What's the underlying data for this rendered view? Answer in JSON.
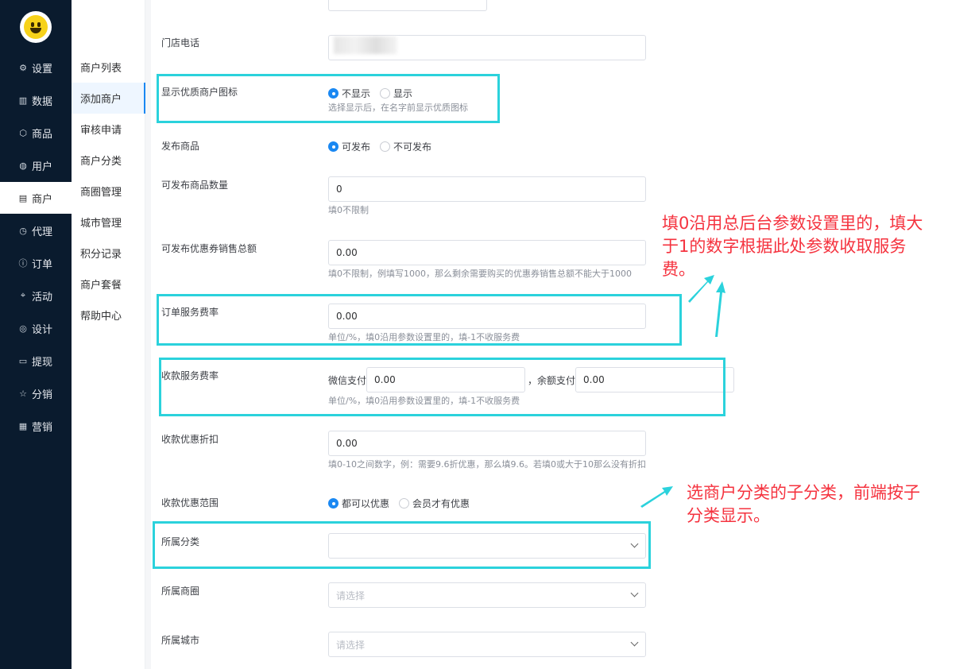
{
  "sidebar": {
    "items": [
      {
        "icon": "gear-icon",
        "glyph": "⚙",
        "label": "设置"
      },
      {
        "icon": "bar-chart-icon",
        "glyph": "▥",
        "label": "数据"
      },
      {
        "icon": "cube-icon",
        "glyph": "⬡",
        "label": "商品"
      },
      {
        "icon": "user-icon",
        "glyph": "◍",
        "label": "用户"
      },
      {
        "icon": "document-icon",
        "glyph": "▤",
        "label": "商户"
      },
      {
        "icon": "clock-icon",
        "glyph": "◷",
        "label": "代理"
      },
      {
        "icon": "info-icon",
        "glyph": "ⓘ",
        "label": "订单"
      },
      {
        "icon": "tag-icon",
        "glyph": "⌖",
        "label": "活动"
      },
      {
        "icon": "palette-icon",
        "glyph": "◎",
        "label": "设计"
      },
      {
        "icon": "card-icon",
        "glyph": "▭",
        "label": "提现"
      },
      {
        "icon": "star-icon",
        "glyph": "☆",
        "label": "分销"
      },
      {
        "icon": "grid-icon",
        "glyph": "▦",
        "label": "营销"
      }
    ],
    "active_index": 4
  },
  "subnav": {
    "items": [
      "商户列表",
      "添加商户",
      "审核申请",
      "商户分类",
      "商圈管理",
      "城市管理",
      "积分记录",
      "商户套餐",
      "帮助中心"
    ],
    "active_index": 1
  },
  "form": {
    "store_phone": {
      "label": "门店电话"
    },
    "show_quality": {
      "label": "显示优质商户图标",
      "options": [
        "不显示",
        "显示"
      ],
      "selected": 0,
      "hint": "选择显示后，在名字前显示优质图标"
    },
    "publish_goods": {
      "label": "发布商品",
      "options": [
        "可发布",
        "不可发布"
      ],
      "selected": 0
    },
    "goods_count": {
      "label": "可发布商品数量",
      "value": "0",
      "hint": "填0不限制"
    },
    "coupon_total": {
      "label": "可发布优惠券销售总额",
      "value": "0.00",
      "hint": "填0不限制，例填写1000，那么剩余需要购买的优惠券销售总额不能大于1000"
    },
    "order_fee": {
      "label": "订单服务费率",
      "value": "0.00",
      "hint": "单位/%，填0沿用参数设置里的，填-1不收服务费"
    },
    "collect_fee": {
      "label": "收款服务费率",
      "wechat_label": "微信支付",
      "wechat_value": "0.00",
      "sep": "，余额支付",
      "balance_value": "0.00",
      "hint": "单位/%，填0沿用参数设置里的，填-1不收服务费"
    },
    "collect_discount": {
      "label": "收款优惠折扣",
      "value": "0.00",
      "hint": "填0-10之间数字，例：需要9.6折优惠，那么填9.6。若填0或大于10那么没有折扣"
    },
    "discount_scope": {
      "label": "收款优惠范围",
      "options": [
        "都可以优惠",
        "会员才有优惠"
      ],
      "selected": 0
    },
    "category": {
      "label": "所属分类",
      "value": ""
    },
    "business_circle": {
      "label": "所属商圈",
      "placeholder": "请选择"
    },
    "city": {
      "label": "所属城市",
      "placeholder": "请选择"
    }
  },
  "annotations": {
    "fee_note": [
      "填0沿用总后台参数设置里的，填大",
      "于1的数字根据此处参数收取服务",
      "费。"
    ],
    "category_note": [
      "选商户分类的子分类，前端按子",
      "分类显示。"
    ]
  },
  "colors": {
    "highlight": "#2bd2dc",
    "annotation": "#f5333f",
    "sidebar_bg": "#0a1b2e",
    "primary": "#1a88f2"
  }
}
